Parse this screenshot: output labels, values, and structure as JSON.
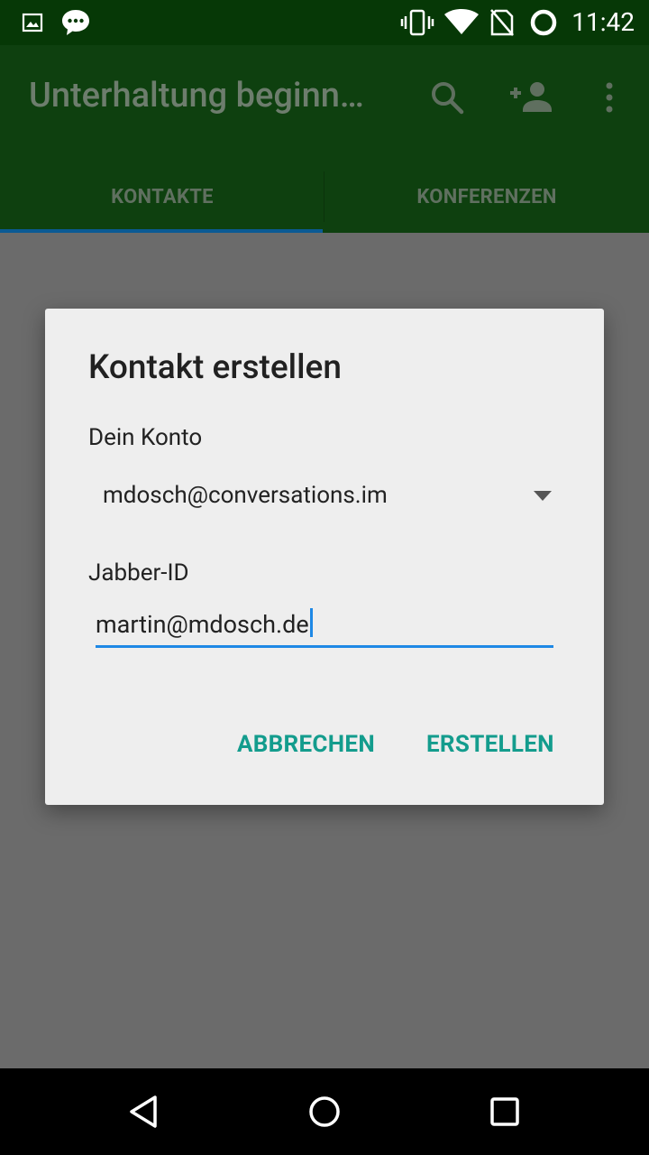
{
  "status_bar": {
    "time": "11:42",
    "icons": [
      "image-icon",
      "chat-icon",
      "vibrate-icon",
      "wifi-icon",
      "no-sim-icon",
      "sync-circle-icon"
    ]
  },
  "appbar": {
    "title": "Unterhaltung beginn…",
    "actions": [
      "search-icon",
      "add-person-icon",
      "more-vert-icon"
    ]
  },
  "tabs": [
    {
      "label": "KONTAKTE",
      "selected": true
    },
    {
      "label": "KONFERENZEN",
      "selected": false
    }
  ],
  "dialog": {
    "title": "Kontakt erstellen",
    "account_label": "Dein Konto",
    "account_value": "mdosch@conversations.im",
    "jid_label": "Jabber-ID",
    "jid_value": "martin@mdosch.de",
    "cancel_label": "ABBRECHEN",
    "create_label": "ERSTELLEN"
  },
  "navbar": {
    "buttons": [
      "back-icon",
      "home-icon",
      "recents-icon"
    ]
  },
  "colors": {
    "accent": "#139c8d",
    "input_underline": "#1e88e5",
    "appbar": "#0e400f",
    "statusbar": "#063806"
  }
}
